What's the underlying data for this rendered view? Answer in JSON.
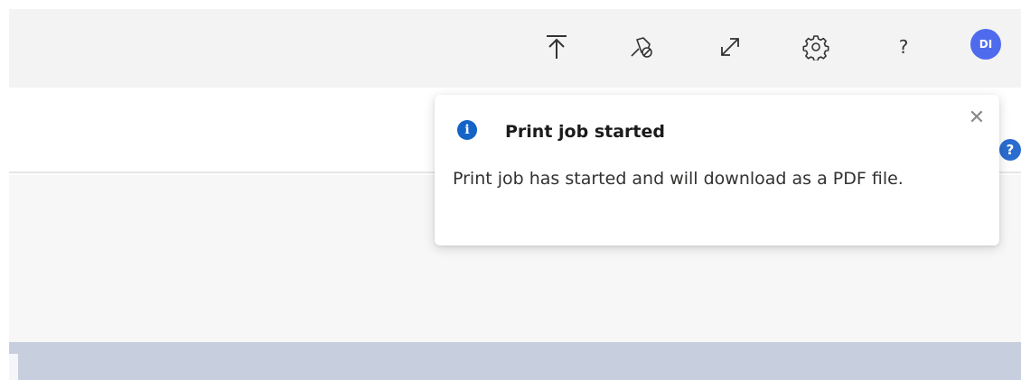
{
  "topbar": {
    "buttons": [
      {
        "name": "scroll-to-top",
        "icon": "arrow-up-to-line-icon"
      },
      {
        "name": "unpin",
        "icon": "pin-off-icon"
      },
      {
        "name": "expand",
        "icon": "expand-diagonal-icon"
      },
      {
        "name": "settings",
        "icon": "gear-icon"
      },
      {
        "name": "help",
        "icon": "question-mark-icon",
        "glyph": "?"
      }
    ],
    "avatar_initials": "DI",
    "avatar_color": "#4f6bed"
  },
  "side_help": {
    "glyph": "?",
    "color": "#2b6cd0"
  },
  "toast": {
    "icon": "info-icon",
    "icon_glyph": "i",
    "icon_color": "#1463c7",
    "title": "Print job started",
    "body": "Print job has started and will download as a PDF file.",
    "close_glyph": "✕"
  },
  "colors": {
    "topbar_bg": "#f3f3f3",
    "content_bg": "#f7f7f7",
    "grid_header_bg": "#c7cedd"
  }
}
